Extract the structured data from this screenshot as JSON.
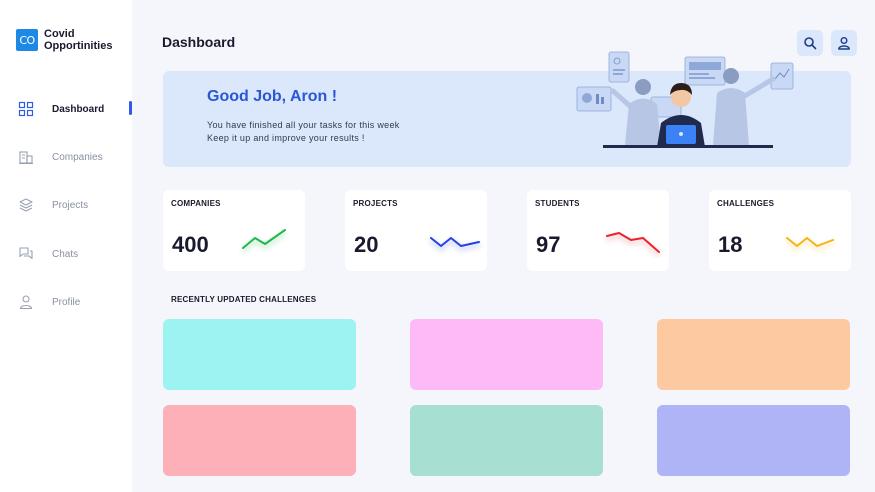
{
  "app": {
    "logo_mark": "CO",
    "name": "Covid Opportinities"
  },
  "sidebar": {
    "items": [
      {
        "label": "Dashboard",
        "icon": "dashboard-grid-icon",
        "active": true
      },
      {
        "label": "Companies",
        "icon": "building-icon",
        "active": false
      },
      {
        "label": "Projects",
        "icon": "layers-icon",
        "active": false
      },
      {
        "label": "Chats",
        "icon": "chat-bubbles-icon",
        "active": false
      },
      {
        "label": "Profile",
        "icon": "user-icon",
        "active": false
      }
    ]
  },
  "header": {
    "title": "Dashboard",
    "search_icon": "search-icon",
    "profile_icon": "user-icon"
  },
  "banner": {
    "title": "Good Job, Aron !",
    "line1": "You have finished all your tasks for this week",
    "line2": "Keep it up and improve your results !"
  },
  "stats": [
    {
      "label": "COMPANIES",
      "value": "400",
      "trend": "up",
      "color": "#1fb84a"
    },
    {
      "label": "PROJECTS",
      "value": "20",
      "trend": "wave",
      "color": "#2441e6"
    },
    {
      "label": "STUDENTS",
      "value": "97",
      "trend": "down",
      "color": "#e8242c"
    },
    {
      "label": "CHALLENGES",
      "value": "18",
      "trend": "wave",
      "color": "#f5b317"
    }
  ],
  "challenges": {
    "title": "RECENTLY UPDATED CHALLENGES",
    "colors": [
      "#9df3f1",
      "#fdbaf7",
      "#fdc9a1",
      "#fdb0b8",
      "#a7dfd2",
      "#afb4f7"
    ]
  },
  "colors": {
    "accent": "#2f5bea",
    "banner_bg": "#dbe7fb",
    "page_bg": "#f4f6fb"
  }
}
